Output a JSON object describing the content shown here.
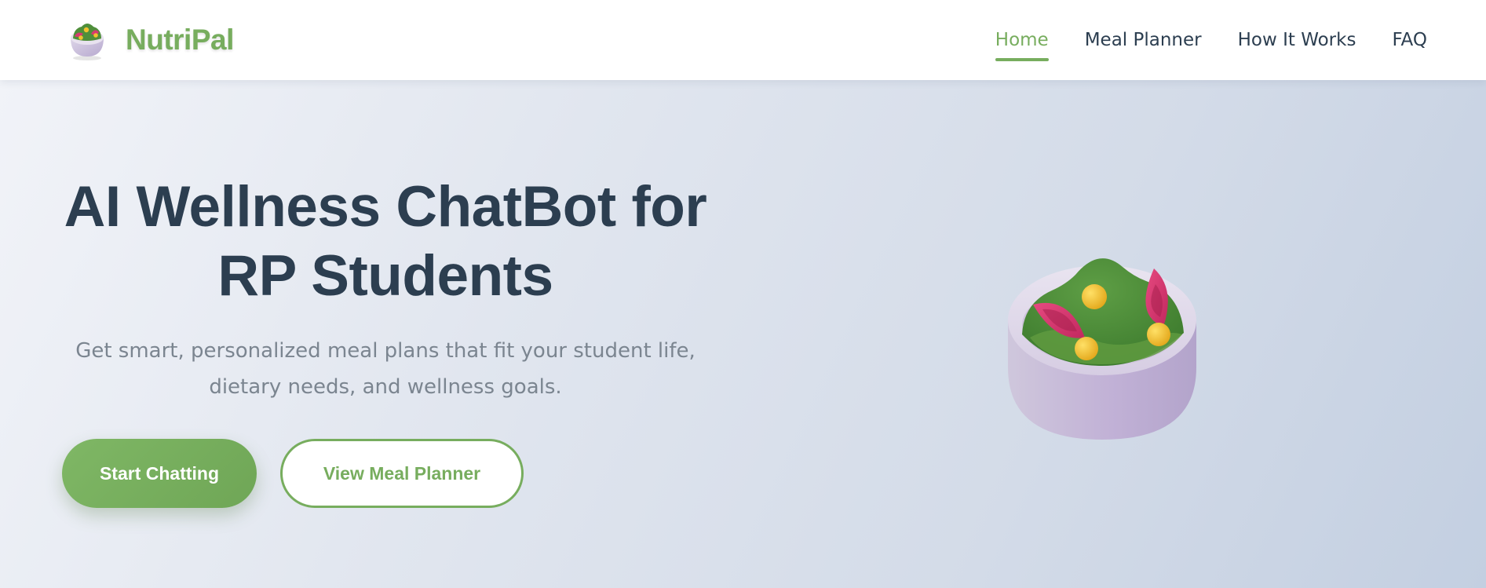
{
  "brand": {
    "name": "NutriPal",
    "logo_icon": "salad-bowl-icon"
  },
  "nav": {
    "items": [
      {
        "label": "Home",
        "active": true
      },
      {
        "label": "Meal Planner",
        "active": false
      },
      {
        "label": "How It Works",
        "active": false
      },
      {
        "label": "FAQ",
        "active": false
      }
    ]
  },
  "hero": {
    "title_line1": "AI Wellness ChatBot for",
    "title_line2": "RP Students",
    "subtitle_line1": "Get smart, personalized meal plans that fit your student life,",
    "subtitle_line2": "dietary needs, and wellness goals.",
    "primary_button": "Start Chatting",
    "secondary_button": "View Meal Planner",
    "illustration_icon": "salad-bowl-icon"
  },
  "colors": {
    "accent": "#77ad5e",
    "heading": "#2c3e50",
    "subtitle": "#7b8590",
    "bowl": "#c9bedb",
    "greens": "#4f8f3a",
    "radish": "#d63a70",
    "corn": "#f2c12e"
  }
}
